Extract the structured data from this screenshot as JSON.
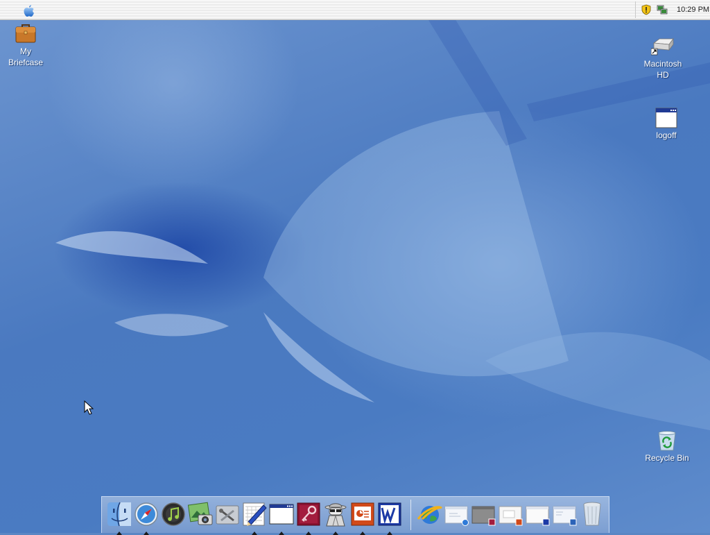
{
  "menubar": {
    "apple_menu_icon": "apple-logo-icon",
    "tray": {
      "icons": [
        "security-shield-icon",
        "network-connection-icon"
      ],
      "clock": "10:29 PM"
    }
  },
  "desktop": {
    "icons": {
      "briefcase": {
        "label_line1": "My",
        "label_line2": "Briefcase",
        "icon": "briefcase-icon"
      },
      "macintosh_hd": {
        "label_line1": "Macintosh",
        "label_line2": "HD",
        "icon": "hard-drive-icon"
      },
      "logoff": {
        "label": "logoff",
        "icon": "window-icon"
      },
      "recycle_bin": {
        "label": "Recycle Bin",
        "icon": "recycle-bin-icon"
      }
    }
  },
  "dock": {
    "apps": [
      {
        "icon": "finder-icon",
        "running": true
      },
      {
        "icon": "safari-compass-icon",
        "running": true
      },
      {
        "icon": "itunes-icon",
        "running": false
      },
      {
        "icon": "iphoto-icon",
        "running": false
      },
      {
        "icon": "system-tools-icon",
        "running": false
      },
      {
        "icon": "editor-pencil-icon",
        "running": true
      },
      {
        "icon": "blank-window-icon",
        "running": true
      },
      {
        "icon": "access-key-icon",
        "running": true
      },
      {
        "icon": "spy-agent-icon",
        "running": true
      },
      {
        "icon": "powerpoint-icon",
        "running": true
      },
      {
        "icon": "word-icon",
        "running": true
      }
    ],
    "minimized": [
      {
        "icon": "internet-explorer-icon"
      },
      {
        "icon": "minimized-window-ie-icon"
      },
      {
        "icon": "minimized-window-access-icon"
      },
      {
        "icon": "minimized-window-powerpoint-icon"
      },
      {
        "icon": "minimized-window-word-icon"
      },
      {
        "icon": "minimized-window-outlook-icon"
      },
      {
        "icon": "trash-icon"
      }
    ]
  },
  "colors": {
    "desktop_blue": "#4a79c0",
    "menubar": "#f2f2f2",
    "label_text": "#ffffff"
  }
}
